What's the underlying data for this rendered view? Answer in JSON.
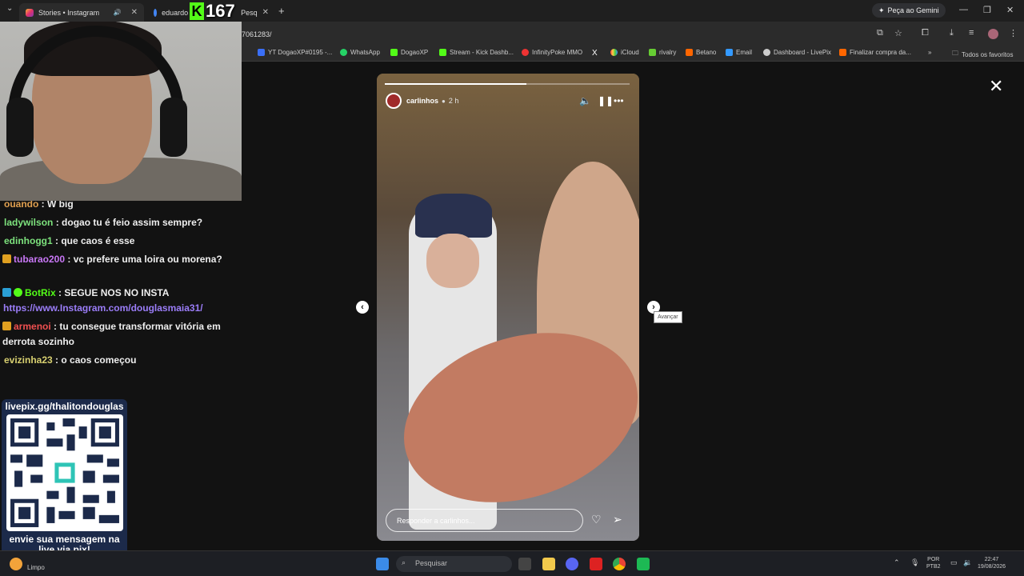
{
  "browser": {
    "tabs": [
      {
        "title": "Stories • Instagram"
      },
      {
        "title": "eduardo"
      },
      {
        "title": "Pesq"
      }
    ],
    "gemini_label": "Peça ao Gemini",
    "url_fragment": "7061283/",
    "bookmarks": [
      {
        "label": "YT DogaoXP#0195 -...",
        "color": "#3a6ff7"
      },
      {
        "label": "WhatsApp",
        "color": "#25d366"
      },
      {
        "label": "DogaoXP",
        "color": "#53fc18"
      },
      {
        "label": "Stream - Kick Dashb...",
        "color": "#53fc18"
      },
      {
        "label": "InfinityPoke MMO",
        "color": "#e33"
      },
      {
        "label": "X",
        "color": "#000"
      },
      {
        "label": "iCloud",
        "color": "#ccc"
      },
      {
        "label": "rivalry",
        "color": "#6c3"
      },
      {
        "label": "Betano",
        "color": "#f60"
      },
      {
        "label": "Email",
        "color": "#39f"
      },
      {
        "label": "Dashboard - LivePix",
        "color": "#ccc"
      },
      {
        "label": "Finalizar compra da...",
        "color": "#f60"
      }
    ],
    "favorites_label": "Todos os favoritos"
  },
  "overlay": {
    "kick_count": "167",
    "kick_logo": "K"
  },
  "chat": {
    "messages": [
      {
        "user": "ouando",
        "user_color": "#e0a050",
        "text": "W big",
        "badge": ""
      },
      {
        "user": "ladywilson",
        "user_color": "#7de27d",
        "text": "dogao tu é feio assim sempre?",
        "badge": ""
      },
      {
        "user": "edinhogg1",
        "user_color": "#7de27d",
        "text": "que caos é esse",
        "badge": ""
      },
      {
        "user": "tubarao200",
        "user_color": "#c877f5",
        "text": "vc prefere uma loira ou morena?",
        "badge": "crown"
      },
      {
        "user": "BotRix",
        "user_color": "#53fc18",
        "text": "SEGUE NOS NO INSTA",
        "badge": "bot"
      },
      {
        "link": "https://www.Instagram.com/douglasmaia31/"
      },
      {
        "user": "armenoi",
        "user_color": "#f05050",
        "text": "tu consegue transformar vitória em derrota sozinho",
        "badge": "crown"
      },
      {
        "user": "evizinha23",
        "user_color": "#d8d070",
        "text": "o caos começou",
        "badge": ""
      }
    ]
  },
  "qr_panel": {
    "top_text": "livepix.gg/thalitondouglas",
    "bottom_text": "envie sua mensagem na live via pix!"
  },
  "story": {
    "username": "carlinhos",
    "time": "2 h",
    "reply_placeholder": "Responder a carlinhos...",
    "progress": 0.58,
    "icons": {
      "mute": "speaker-icon",
      "pause": "pause-icon",
      "more": "more-icon",
      "like": "heart-icon",
      "share": "send-icon"
    }
  },
  "viewer": {
    "prev": "‹",
    "next": "›",
    "next_tooltip": "Avançar",
    "close": "✕"
  },
  "taskbar": {
    "weather": "Limpo",
    "search_placeholder": "Pesquisar",
    "lang_top": "POR",
    "lang_bottom": "PTB2",
    "clock_time": "22:47",
    "clock_date": "19/08/2026"
  }
}
